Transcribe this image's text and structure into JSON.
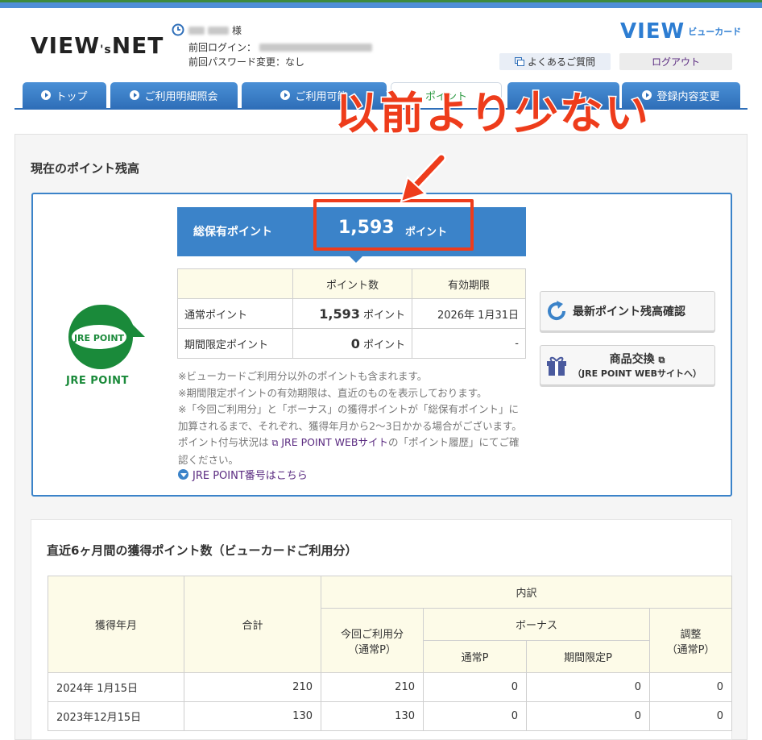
{
  "header": {
    "logo_main": "VIEW",
    "logo_small": "'s",
    "logo_net": "NET",
    "user_suffix": "様",
    "last_login_label": "前回ログイン：",
    "last_password_change": "前回パスワード変更：なし",
    "brand_logo": "VIEW",
    "brand_text": "ビューカード",
    "faq_label": "よくあるご質問",
    "logout_label": "ログアウト"
  },
  "nav": {
    "tabs": [
      {
        "label": "トップ"
      },
      {
        "label": "ご利用明細照会"
      },
      {
        "label": "ご利用可能"
      },
      {
        "label": "ポイント"
      },
      {
        "label": ""
      },
      {
        "label": "登録内容変更"
      }
    ]
  },
  "annotation": {
    "text": "以前より少ない"
  },
  "current": {
    "heading": "現在のポイント残高",
    "jre_badge": "JRE POINT",
    "jre_label": "JRE POINT",
    "total_label": "総保有ポイント",
    "total_value": "1,593",
    "total_unit": "ポイント",
    "table": {
      "headers": [
        "",
        "ポイント数",
        "有効期限"
      ],
      "rows": [
        {
          "name": "通常ポイント",
          "value": "1,593",
          "unit": "ポイント",
          "expiry": "2026年 1月31日"
        },
        {
          "name": "期間限定ポイント",
          "value": "0",
          "unit": "ポイント",
          "expiry": "-"
        }
      ]
    },
    "btn_refresh": "最新ポイント残高確認",
    "btn_exchange": "商品交換",
    "btn_exchange_sub": "（JRE POINT WEBサイトへ）",
    "notes": {
      "line1": "※ビューカードご利用分以外のポイントも含まれます。",
      "line2": "※期間限定ポイントの有効期限は、直近のものを表示しております。",
      "line3": "※「今回ご利用分」と「ボーナス」の獲得ポイントが「総保有ポイント」に加算されるまで、それぞれ、獲得年月から2～3日かかる場合がございます。ポイント付与状況は",
      "link": "JRE POINT WEBサイト",
      "line3_end": "の「ポイント履歴」にてご確認ください。"
    },
    "jre_number_link": "JRE POINT番号はこちら"
  },
  "history": {
    "heading": "直近6ヶ月間の獲得ポイント数（ビューカードご利用分）",
    "col_month": "獲得年月",
    "col_total": "合計",
    "col_breakdown": "内訳",
    "col_this_use": "今回ご利用分",
    "col_this_use_sub": "（通常P）",
    "col_bonus": "ボーナス",
    "col_bonus_normal": "通常P",
    "col_bonus_limited": "期間限定P",
    "col_adjust": "調整",
    "col_adjust_sub": "（通常P）",
    "rows": [
      {
        "month": "2024年 1月15日",
        "total": "210",
        "this_use": "210",
        "bonus_normal": "0",
        "bonus_limited": "0",
        "adjust": "0"
      },
      {
        "month": "2023年12月15日",
        "total": "130",
        "this_use": "130",
        "bonus_normal": "0",
        "bonus_limited": "0",
        "adjust": "0"
      }
    ]
  },
  "colors": {
    "accent_blue": "#3b83c9",
    "annotation_red": "#ee3c1b",
    "jre_green": "#1a8a3a",
    "header_cell": "#fdfbe8"
  }
}
